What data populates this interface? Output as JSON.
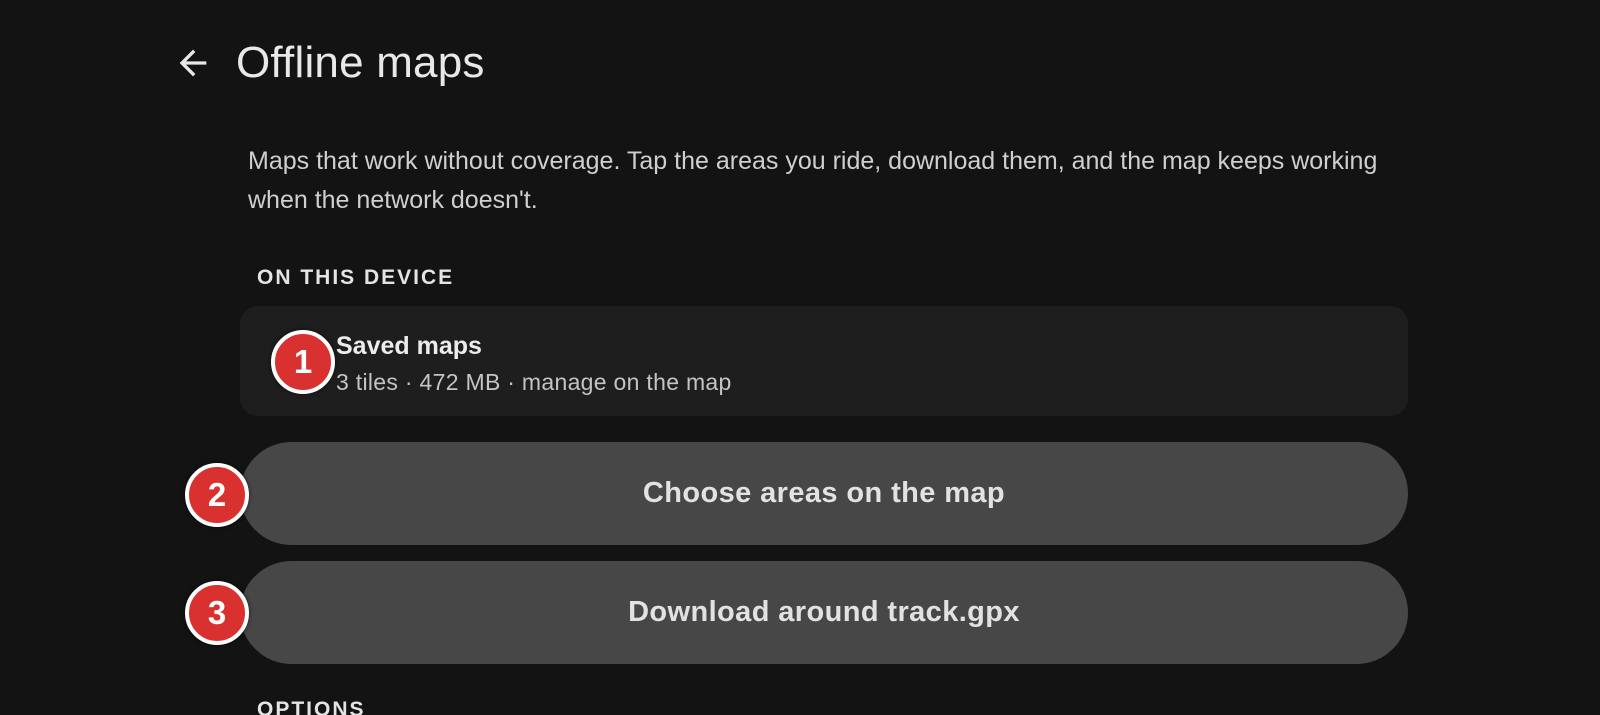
{
  "header": {
    "title": "Offline maps",
    "back_icon": "arrow-left-icon"
  },
  "intro": {
    "text": "Maps that work without coverage. Tap the areas you ride, download them, and the map keeps working when the network doesn't."
  },
  "sections": {
    "on_device_label": "ON THIS DEVICE",
    "options_label": "OPTIONS"
  },
  "saved_maps": {
    "title": "Saved maps",
    "subtitle": "3 tiles · 472 MB · manage on the map"
  },
  "actions": {
    "choose_areas_label": "Choose areas on the map",
    "download_track_label": "Download around track.gpx"
  },
  "annotations": {
    "badge_1": "1",
    "badge_2": "2",
    "badge_3": "3"
  },
  "colors": {
    "background": "#131313",
    "card": "#1e1e1e",
    "button": "#474747",
    "badge": "#d93030"
  }
}
